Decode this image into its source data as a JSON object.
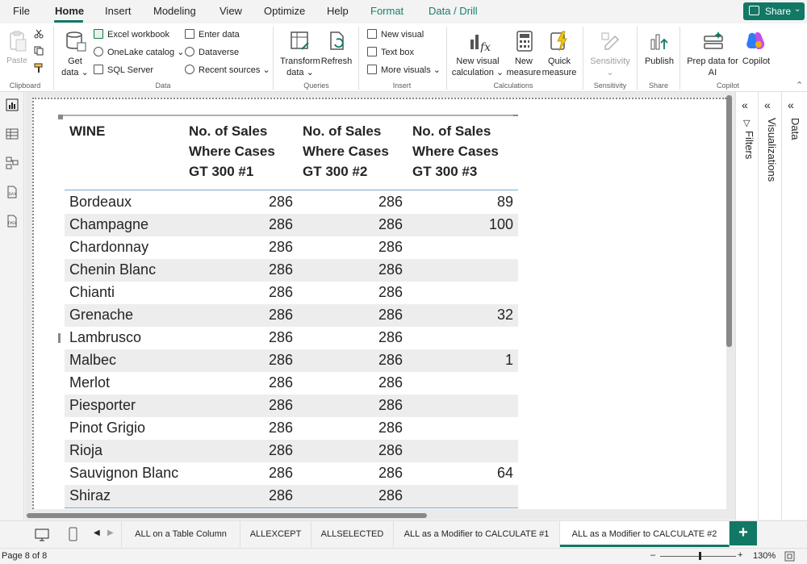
{
  "menu": {
    "items": [
      "File",
      "Home",
      "Insert",
      "Modeling",
      "View",
      "Optimize",
      "Help",
      "Format",
      "Data / Drill"
    ],
    "share_label": "Share"
  },
  "ribbon": {
    "clipboard": {
      "paste": "Paste",
      "label": "Clipboard"
    },
    "data": {
      "get_data_1": "Get",
      "get_data_2": "data",
      "excel": "Excel workbook",
      "onelake": "OneLake catalog",
      "sql": "SQL Server",
      "enter": "Enter data",
      "dataverse": "Dataverse",
      "recent": "Recent sources",
      "label": "Data"
    },
    "queries": {
      "transform_1": "Transform",
      "transform_2": "data",
      "refresh": "Refresh",
      "label": "Queries"
    },
    "insert": {
      "new_visual": "New visual",
      "text_box": "Text box",
      "more_visuals": "More visuals",
      "label": "Insert"
    },
    "calculations": {
      "new_visual_calc_1": "New visual",
      "new_visual_calc_2": "calculation",
      "new_measure_1": "New",
      "new_measure_2": "measure",
      "quick_measure_1": "Quick",
      "quick_measure_2": "measure",
      "label": "Calculations"
    },
    "sensitivity": {
      "btn": "Sensitivity",
      "label": "Sensitivity"
    },
    "share": {
      "publish": "Publish",
      "label": "Share"
    },
    "copilot": {
      "prep_1": "Prep data for",
      "prep_2": "AI",
      "copilot": "Copilot",
      "label": "Copilot"
    }
  },
  "table": {
    "headers": [
      "WINE",
      "No. of Sales Where Cases GT 300 #1",
      "No. of Sales Where Cases GT 300 #2",
      "No. of Sales Where Cases GT 300 #3"
    ],
    "header_lines": [
      [
        "WINE"
      ],
      [
        "No. of Sales",
        "Where Cases",
        "GT 300 #1"
      ],
      [
        "No. of Sales",
        "Where Cases",
        "GT 300 #2"
      ],
      [
        "No. of Sales",
        "Where Cases",
        "GT 300 #3"
      ]
    ],
    "rows": [
      [
        "Bordeaux",
        "286",
        "286",
        "89"
      ],
      [
        "Champagne",
        "286",
        "286",
        "100"
      ],
      [
        "Chardonnay",
        "286",
        "286",
        ""
      ],
      [
        "Chenin Blanc",
        "286",
        "286",
        ""
      ],
      [
        "Chianti",
        "286",
        "286",
        ""
      ],
      [
        "Grenache",
        "286",
        "286",
        "32"
      ],
      [
        "Lambrusco",
        "286",
        "286",
        ""
      ],
      [
        "Malbec",
        "286",
        "286",
        "1"
      ],
      [
        "Merlot",
        "286",
        "286",
        ""
      ],
      [
        "Piesporter",
        "286",
        "286",
        ""
      ],
      [
        "Pinot Grigio",
        "286",
        "286",
        ""
      ],
      [
        "Rioja",
        "286",
        "286",
        ""
      ],
      [
        "Sauvignon Blanc",
        "286",
        "286",
        "64"
      ],
      [
        "Shiraz",
        "286",
        "286",
        ""
      ]
    ]
  },
  "panes": {
    "filters": "Filters",
    "visualizations": "Visualizations",
    "data": "Data"
  },
  "tabs": [
    "ALL on a Table Column",
    "ALLEXCEPT",
    "ALLSELECTED",
    "ALL as a Modifier to CALCULATE #1",
    "ALL as a Modifier to CALCULATE #2"
  ],
  "status": {
    "page": "Page 8 of 8",
    "zoom": "130%"
  },
  "colors": {
    "accent": "#117865",
    "context_tab": "#1a7d6b"
  }
}
